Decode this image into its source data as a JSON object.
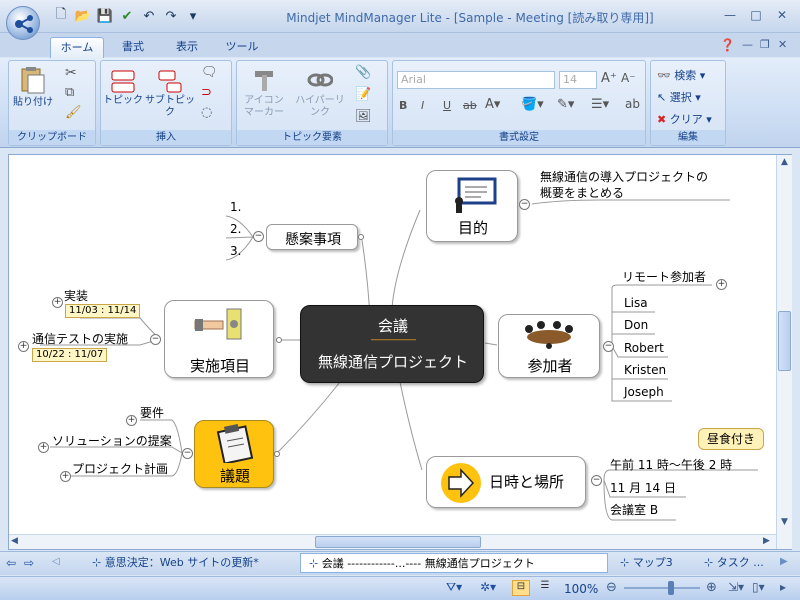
{
  "window": {
    "title": "Mindjet MindManager Lite - [Sample - Meeting [読み取り専用]]",
    "controls": [
      "—",
      "□",
      "✕"
    ]
  },
  "ribbon_tabs": [
    {
      "label": "ホーム",
      "active": true
    },
    {
      "label": "書式",
      "active": false
    },
    {
      "label": "表示",
      "active": false
    },
    {
      "label": "ツール",
      "active": false
    }
  ],
  "ribbon": {
    "clipboard": {
      "label": "クリップボード",
      "paste": "貼り付け"
    },
    "insert": {
      "label": "挿入",
      "topic": "トピック",
      "subtopic": "サブトピック"
    },
    "topic_elements": {
      "label": "トピック要素",
      "icon_marker": "アイコン マーカー",
      "hyperlink": "ハイパーリンク"
    },
    "format": {
      "label": "書式設定",
      "font": "Arial",
      "size": "14"
    },
    "edit": {
      "label": "編集",
      "search": "検索",
      "select": "選択",
      "clear": "クリア"
    }
  },
  "map": {
    "central": {
      "line1": "会議",
      "dashes": "--------------------",
      "line2": "無線通信プロジェクト"
    },
    "purpose": {
      "label": "目的",
      "note_line1": "無線通信の導入プロジェクトの",
      "note_line2": "概要をまとめる"
    },
    "pending": {
      "label": "懸案事項",
      "items": [
        "1.",
        "2.",
        "3."
      ]
    },
    "participants": {
      "label": "参加者",
      "remote": "リモート参加者",
      "names": [
        "Lisa",
        "Don",
        "Robert",
        "Kristen",
        "Joseph"
      ]
    },
    "implementation": {
      "label": "実施項目",
      "tasks": [
        {
          "label": "実装",
          "dates": "11/03 : 11/14"
        },
        {
          "label": "通信テストの実施",
          "dates": "10/22 : 11/07"
        }
      ]
    },
    "agenda": {
      "label": "議題",
      "items": [
        "要件",
        "ソリューションの提案",
        "プロジェクト計画"
      ]
    },
    "datetime": {
      "label": "日時と場所",
      "callout": "昼食付き",
      "time": "午前 11 時～午後 2 時",
      "date": "11 月 14 日",
      "room": "会議室 B"
    }
  },
  "doc_tabs": [
    {
      "label": "意思決定：Web サイトの更新*",
      "active": false
    },
    {
      "label": "会議 ------------...---- 無線通信プロジェクト",
      "active": true
    },
    {
      "label": "マップ3",
      "active": false
    },
    {
      "label": "タスク ...",
      "active": false
    }
  ],
  "status": {
    "zoom": "100%"
  },
  "colors": {
    "central_bg": "#333333",
    "central_dashes": "#f0a020",
    "callout_bg": "#fff2b8",
    "agenda_bg": "#ffc20e"
  }
}
